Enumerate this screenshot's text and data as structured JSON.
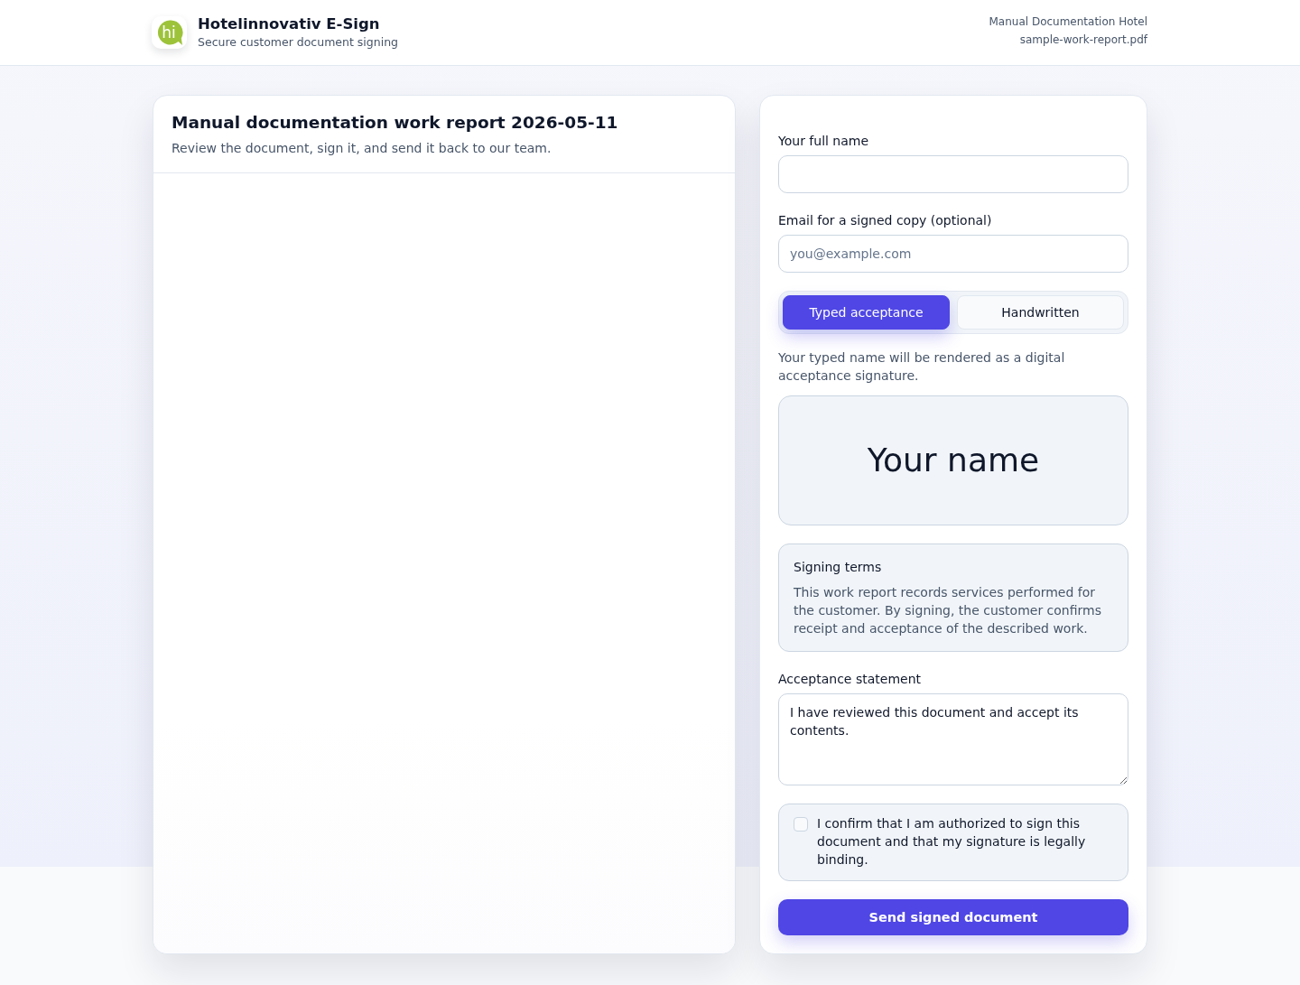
{
  "header": {
    "logo_text": "hi",
    "title": "Hotelinnovativ E-Sign",
    "subtitle": "Secure customer document signing",
    "meta": [
      "Manual Documentation Hotel",
      "sample-work-report.pdf"
    ]
  },
  "document": {
    "title": "Manual documentation work report 2026-05-11",
    "subtitle": "Review the document, sign it, and send it back to our team."
  },
  "form": {
    "full_name": {
      "label": "Your full name"
    },
    "email": {
      "label": "Email for a signed copy (optional)",
      "placeholder": "you@example.com"
    },
    "signature_modes": [
      {
        "label": "Typed acceptance",
        "selected": true
      },
      {
        "label": "Handwritten",
        "selected": false
      }
    ],
    "hint": "Your typed name will be rendered as a digital acceptance signature.",
    "signature_preview": "Your name",
    "terms": {
      "title": "Signing terms",
      "text": "This work report records services performed for the customer. By signing, the customer confirms receipt and acceptance of the described work."
    },
    "statement": {
      "label": "Acceptance statement",
      "value": "I have reviewed this document and accept its contents."
    },
    "confirmation": {
      "checked": false,
      "text": "I confirm that I am authorized to sign this document and that my signature is legally binding."
    },
    "submit": "Send signed document"
  }
}
